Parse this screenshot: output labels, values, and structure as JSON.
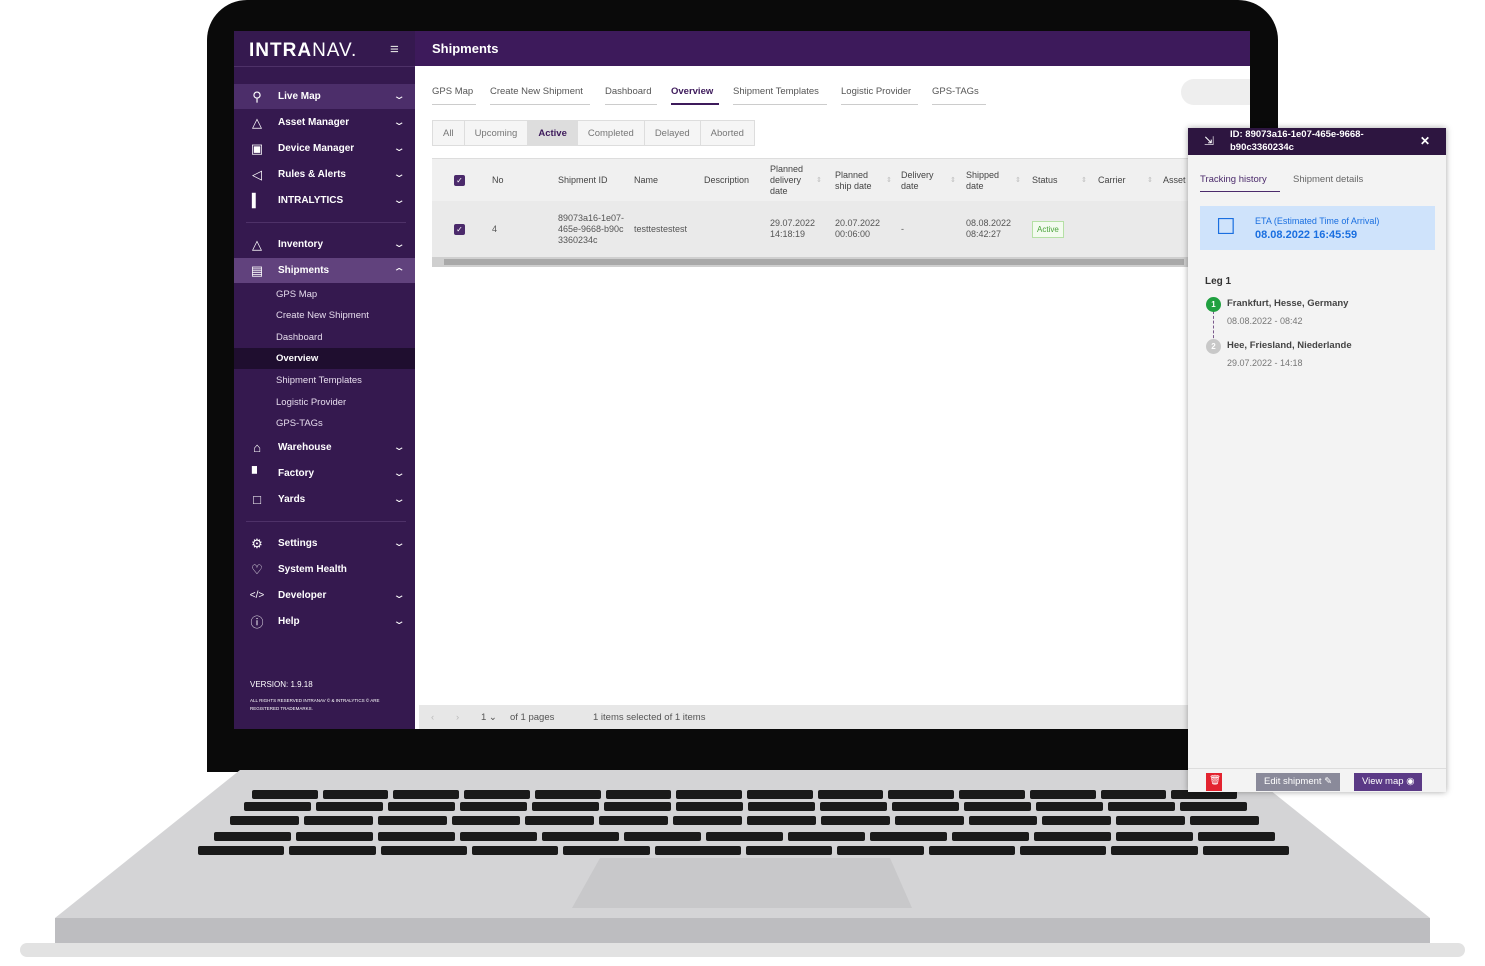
{
  "sidebar": {
    "logo_bold": "INTRA",
    "logo_light": "NAV.",
    "items": [
      {
        "label": "Live Map",
        "icon": "map-pin-icon"
      },
      {
        "label": "Asset Manager",
        "icon": "cube-plus-icon"
      },
      {
        "label": "Device Manager",
        "icon": "chip-icon"
      },
      {
        "label": "Rules & Alerts",
        "icon": "megaphone-icon"
      },
      {
        "label": "INTRALYTICS",
        "icon": "bar-chart-icon"
      },
      {
        "label": "Inventory",
        "icon": "cube-plus-icon"
      },
      {
        "label": "Shipments",
        "icon": "shipment-icon"
      },
      {
        "label": "Warehouse",
        "icon": "warehouse-icon"
      },
      {
        "label": "Factory",
        "icon": "factory-icon"
      },
      {
        "label": "Yards",
        "icon": "yard-icon"
      },
      {
        "label": "Settings",
        "icon": "gear-icon"
      },
      {
        "label": "System Health",
        "icon": "heart-icon"
      },
      {
        "label": "Developer",
        "icon": "code-icon"
      },
      {
        "label": "Help",
        "icon": "help-icon"
      }
    ],
    "shipments_sub": [
      "GPS Map",
      "Create New Shipment",
      "Dashboard",
      "Overview",
      "Shipment Templates",
      "Logistic Provider",
      "GPS-TAGs"
    ],
    "version": "VERSION:  1.9.18",
    "rights": "ALL RIGHTS RESERVED INTRANAV © & INTRALYTICS © ARE REGISTERED TRADEMARKS."
  },
  "header": {
    "title": "Shipments"
  },
  "tabs": [
    "GPS Map",
    "Create New Shipment",
    "Dashboard",
    "Overview",
    "Shipment Templates",
    "Logistic Provider",
    "GPS-TAGs"
  ],
  "active_tab": "Overview",
  "filters": [
    "All",
    "Upcoming",
    "Active",
    "Completed",
    "Delayed",
    "Aborted"
  ],
  "active_filter": "Active",
  "table": {
    "columns": [
      "No",
      "Shipment ID",
      "Name",
      "Description",
      "Planned delivery date",
      "Planned ship date",
      "Delivery date",
      "Shipped date",
      "Status",
      "Carrier",
      "Asset"
    ],
    "rows": [
      {
        "no": "4",
        "shipment_id": "89073a16-1e07-465e-9668-b90c3360234c",
        "name": "testtestestest",
        "description": "",
        "planned_delivery": "29.07.2022 14:18:19",
        "planned_ship": "20.07.2022 00:06:00",
        "delivery": "-",
        "shipped": "08.08.2022 08:42:27",
        "status": "Active",
        "carrier": "",
        "asset": ""
      }
    ]
  },
  "footer": {
    "page": "1",
    "of_pages": "of 1 pages",
    "selection": "1 items selected of 1 items"
  },
  "panel": {
    "title": "ID: 89073a16-1e07-465e-9668-b90c3360234c",
    "tabs": [
      "Tracking history",
      "Shipment details"
    ],
    "eta_label": "ETA (Estimated Time of Arrival)",
    "eta_value": "08.08.2022 16:45:59",
    "leg_title": "Leg 1",
    "stops": [
      {
        "n": "1",
        "location": "Frankfurt, Hesse, Germany",
        "date": "08.08.2022 - 08:42"
      },
      {
        "n": "2",
        "location": "Hee, Friesland, Niederlande",
        "date": "29.07.2022 - 14:18"
      }
    ],
    "edit_label": "Edit shipment",
    "view_map_label": "View map"
  },
  "colors": {
    "sidebar": "#35194f",
    "header": "#3d1a5b",
    "accent": "#4b2a6b",
    "eta_bg": "#cfe3fb",
    "eta_text": "#1a6fe0",
    "delete": "#e3232f"
  }
}
